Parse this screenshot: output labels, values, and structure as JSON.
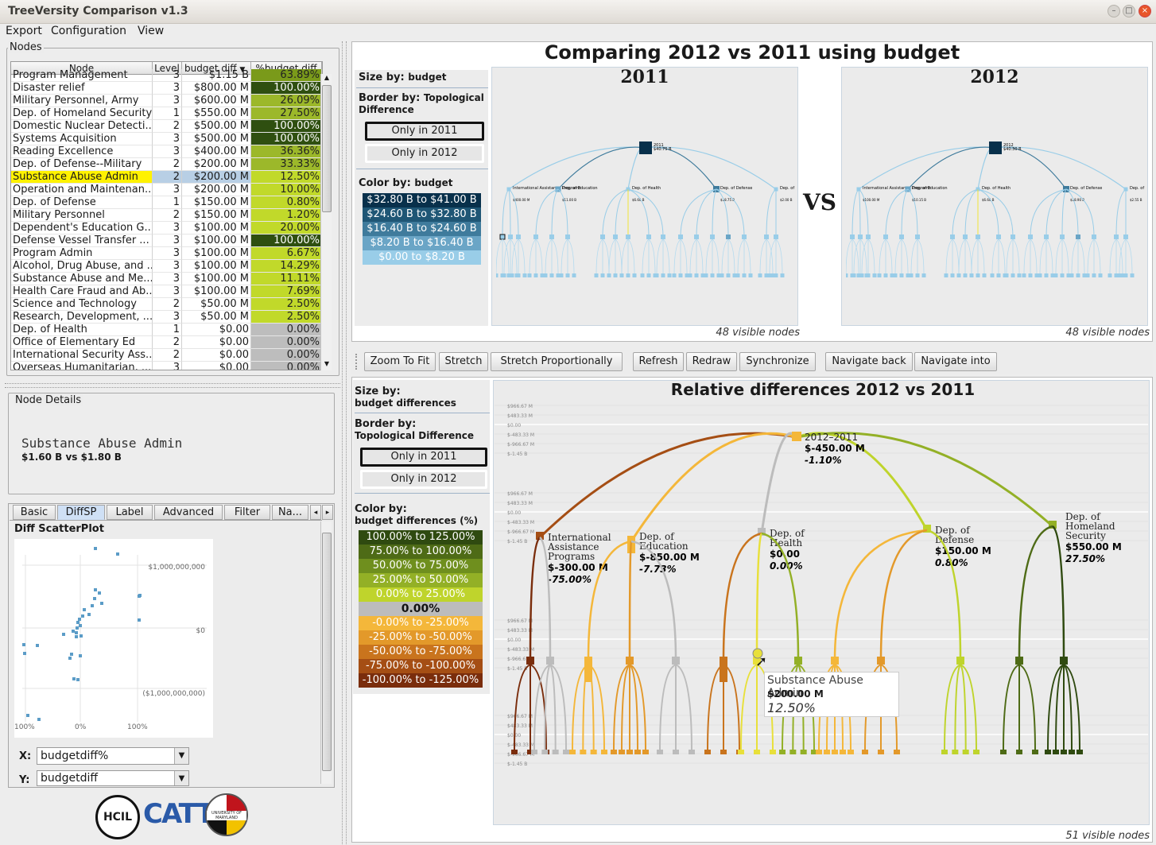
{
  "window": {
    "title": "TreeVersity Comparison v1.3"
  },
  "menu": [
    "Export",
    "Configuration",
    "View"
  ],
  "nodes_panel": {
    "title": "Nodes",
    "columns": [
      "Node",
      "Level",
      "budget diff",
      "%budget diff"
    ],
    "sort_indicator": "▼",
    "rows": [
      {
        "node": "Program Management",
        "level": "3",
        "diff": "$1.15 B",
        "pct": "63.89%",
        "color": "#7a9a1a"
      },
      {
        "node": "Disaster relief",
        "level": "3",
        "diff": "$800.00 M",
        "pct": "100.00%",
        "color": "#2f4f10"
      },
      {
        "node": "Military Personnel, Army",
        "level": "3",
        "diff": "$600.00 M",
        "pct": "26.09%",
        "color": "#9cb82a"
      },
      {
        "node": "Dep. of Homeland Security",
        "level": "1",
        "diff": "$550.00 M",
        "pct": "27.50%",
        "color": "#9cb82a"
      },
      {
        "node": "Domestic Nuclear Detecti...",
        "level": "2",
        "diff": "$500.00 M",
        "pct": "100.00%",
        "color": "#2f4f10"
      },
      {
        "node": "Systems Acquisition",
        "level": "3",
        "diff": "$500.00 M",
        "pct": "100.00%",
        "color": "#2f4f10"
      },
      {
        "node": "Reading Excellence",
        "level": "3",
        "diff": "$400.00 M",
        "pct": "36.36%",
        "color": "#9cb82a"
      },
      {
        "node": "Dep. of Defense--Military",
        "level": "2",
        "diff": "$200.00 M",
        "pct": "33.33%",
        "color": "#9cb82a"
      },
      {
        "node": "Substance Abuse Admin",
        "level": "2",
        "diff": "$200.00 M",
        "pct": "12.50%",
        "color": "#c1d92a",
        "selected": true
      },
      {
        "node": "Operation and Maintenan...",
        "level": "3",
        "diff": "$200.00 M",
        "pct": "10.00%",
        "color": "#c1d92a"
      },
      {
        "node": "Dep. of Defense",
        "level": "1",
        "diff": "$150.00 M",
        "pct": "0.80%",
        "color": "#c1d92a"
      },
      {
        "node": "Military Personnel",
        "level": "2",
        "diff": "$150.00 M",
        "pct": "1.20%",
        "color": "#c1d92a"
      },
      {
        "node": "Dependent's Education G...",
        "level": "3",
        "diff": "$100.00 M",
        "pct": "20.00%",
        "color": "#c1d92a"
      },
      {
        "node": "Defense Vessel Transfer ...",
        "level": "3",
        "diff": "$100.00 M",
        "pct": "100.00%",
        "color": "#2f4f10"
      },
      {
        "node": "Program Admin",
        "level": "3",
        "diff": "$100.00 M",
        "pct": "6.67%",
        "color": "#c1d92a"
      },
      {
        "node": "Alcohol, Drug Abuse, and ...",
        "level": "3",
        "diff": "$100.00 M",
        "pct": "14.29%",
        "color": "#c1d92a"
      },
      {
        "node": "Substance Abuse and Me...",
        "level": "3",
        "diff": "$100.00 M",
        "pct": "11.11%",
        "color": "#c1d92a"
      },
      {
        "node": "Health Care Fraud and Ab...",
        "level": "3",
        "diff": "$100.00 M",
        "pct": "7.69%",
        "color": "#c1d92a"
      },
      {
        "node": "Science and Technology",
        "level": "2",
        "diff": "$50.00 M",
        "pct": "2.50%",
        "color": "#c1d92a"
      },
      {
        "node": "Research, Development, ...",
        "level": "3",
        "diff": "$50.00 M",
        "pct": "2.50%",
        "color": "#c1d92a"
      },
      {
        "node": "Dep. of Health",
        "level": "1",
        "diff": "$0.00",
        "pct": "0.00%",
        "color": "#bdbdbd"
      },
      {
        "node": "Office of Elementary Ed",
        "level": "2",
        "diff": "$0.00",
        "pct": "0.00%",
        "color": "#bdbdbd"
      },
      {
        "node": "International Security Ass...",
        "level": "2",
        "diff": "$0.00",
        "pct": "0.00%",
        "color": "#bdbdbd"
      },
      {
        "node": "Overseas Humanitarian, ...",
        "level": "3",
        "diff": "$0.00",
        "pct": "0.00%",
        "color": "#bdbdbd"
      }
    ]
  },
  "node_details": {
    "title": "Node Details",
    "name": "Substance Abuse Admin",
    "values": "$1.60 B vs $1.80 B"
  },
  "tabs": [
    "Basic",
    "DiffSP",
    "Label",
    "Advanced",
    "Filter",
    "Na..."
  ],
  "scatter": {
    "title": "Diff ScatterPlot",
    "y_ticks": [
      "$1,000,000,000",
      "$0",
      "($1,000,000,000)"
    ],
    "x_ticks": [
      "100%",
      "0%",
      "100%"
    ],
    "x_label": "X:",
    "x_value": "budgetdiff%",
    "y_label": "Y:",
    "y_value": "budgetdiff"
  },
  "logos": {
    "hcil": "HCIL",
    "catt": "CATT",
    "umd": "UNIVERSITY OF MARYLAND"
  },
  "comparison": {
    "title": "Comparing 2012 vs 2011 using budget",
    "size_by_label": "Size by:",
    "size_by_value": "budget",
    "border_by_label": "Border by:",
    "border_by_value": "Topological Difference",
    "only_2011": "Only in 2011",
    "only_2012": "Only in 2012",
    "color_by_label": "Color by:",
    "color_by_value": "budget",
    "legend": [
      {
        "label": "$32.80 B to $41.00 B",
        "color": "#08304b"
      },
      {
        "label": "$24.60 B to $32.80 B",
        "color": "#1f5675"
      },
      {
        "label": "$16.40 B to $24.60 B",
        "color": "#3f7b9c"
      },
      {
        "label": "$8.20 B to $16.40 B",
        "color": "#6aa5c6"
      },
      {
        "label": "$0.00    to $8.20 B",
        "color": "#99cde8"
      }
    ],
    "left_year": "2011",
    "right_year": "2012",
    "vs": "VS",
    "left_visible": "48 visible nodes",
    "right_visible": "48 visible nodes",
    "left_tree": {
      "root": "2011",
      "root_val": "$40.75 B",
      "children": [
        {
          "name": "International Assistance Programs",
          "val": "$400.00 M"
        },
        {
          "name": "Dep. of Education",
          "val": "$11.00 B"
        },
        {
          "name": "Dep. of Health",
          "val": "$6.60 B"
        },
        {
          "name": "Dep. of Defense",
          "val": "$18.75 B"
        },
        {
          "name": "Dep. of Homeland Security",
          "val": "$2.00 B"
        }
      ]
    },
    "right_tree": {
      "root": "2012",
      "root_val": "$40.30 B",
      "children": [
        {
          "name": "International Assistance Programs",
          "val": "$100.00 M"
        },
        {
          "name": "Dep. of Education",
          "val": "$10.15 B"
        },
        {
          "name": "Dep. of Health",
          "val": "$6.60 B"
        },
        {
          "name": "Dep. of Defense",
          "val": "$18.90 B"
        },
        {
          "name": "Dep. of Homeland Security",
          "val": "$2.55 B"
        }
      ]
    }
  },
  "toolbar": [
    "Zoom To Fit",
    "Stretch",
    "Stretch Proportionally",
    "Refresh",
    "Redraw",
    "Synchronize",
    "Navigate back",
    "Navigate into"
  ],
  "differences": {
    "title": "Relative differences 2012 vs 2011",
    "size_by_label": "Size by:",
    "size_by_value": "budget differences",
    "border_by_label": "Border by:",
    "border_by_value": "Topological Difference",
    "only_2011": "Only in 2011",
    "only_2012": "Only in 2012",
    "color_by_label": "Color by:",
    "color_by_value": "budget differences (%)",
    "legend": [
      {
        "label": "100.00% to 125.00%",
        "color": "#2f4a10"
      },
      {
        "label": "75.00% to 100.00%",
        "color": "#4e6b16"
      },
      {
        "label": "50.00% to 75.00%",
        "color": "#6f8f1e"
      },
      {
        "label": "25.00% to 50.00%",
        "color": "#93b026"
      },
      {
        "label": "0.00% to 25.00%",
        "color": "#bfd42c"
      },
      {
        "label": "0.00%",
        "color": "#bcbcbc",
        "dark": true
      },
      {
        "label": "-0.00% to -25.00%",
        "color": "#f4b73a"
      },
      {
        "label": "-25.00% to -50.00%",
        "color": "#e3992a"
      },
      {
        "label": "-50.00% to -75.00%",
        "color": "#c9741d"
      },
      {
        "label": "-75.00% to -100.00%",
        "color": "#a54e14"
      },
      {
        "label": "-100.00% to -125.00%",
        "color": "#7a2d0c"
      }
    ],
    "axis_ticks": [
      "$966.67 M",
      "$483.33 M",
      "$0.00",
      "$-483.33 M",
      "$-966.67 M",
      "$-1.45 B"
    ],
    "root": {
      "name": "2012–2011",
      "val": "$-450.00 M",
      "pct": "-1.10%"
    },
    "children": [
      {
        "name": "International Assistance Programs",
        "val": "$-300.00 M",
        "pct": "-75.00%",
        "color": "#a54e14"
      },
      {
        "name": "Dep. of Education",
        "val": "$-850.00 M",
        "pct": "-7.73%",
        "color": "#f4b73a"
      },
      {
        "name": "Dep. of Health",
        "val": "$0.00",
        "pct": "0.00%",
        "color": "#bcbcbc"
      },
      {
        "name": "Dep. of Defense",
        "val": "$150.00 M",
        "pct": "0.80%",
        "color": "#bfd42c"
      },
      {
        "name": "Dep. of Homeland Security",
        "val": "$550.00 M",
        "pct": "27.50%",
        "color": "#93b026"
      }
    ],
    "tooltip": {
      "name": "Substance Abuse Admin",
      "val": "$200.00 M",
      "pct": "12.50%"
    },
    "visible": "51 visible nodes"
  }
}
